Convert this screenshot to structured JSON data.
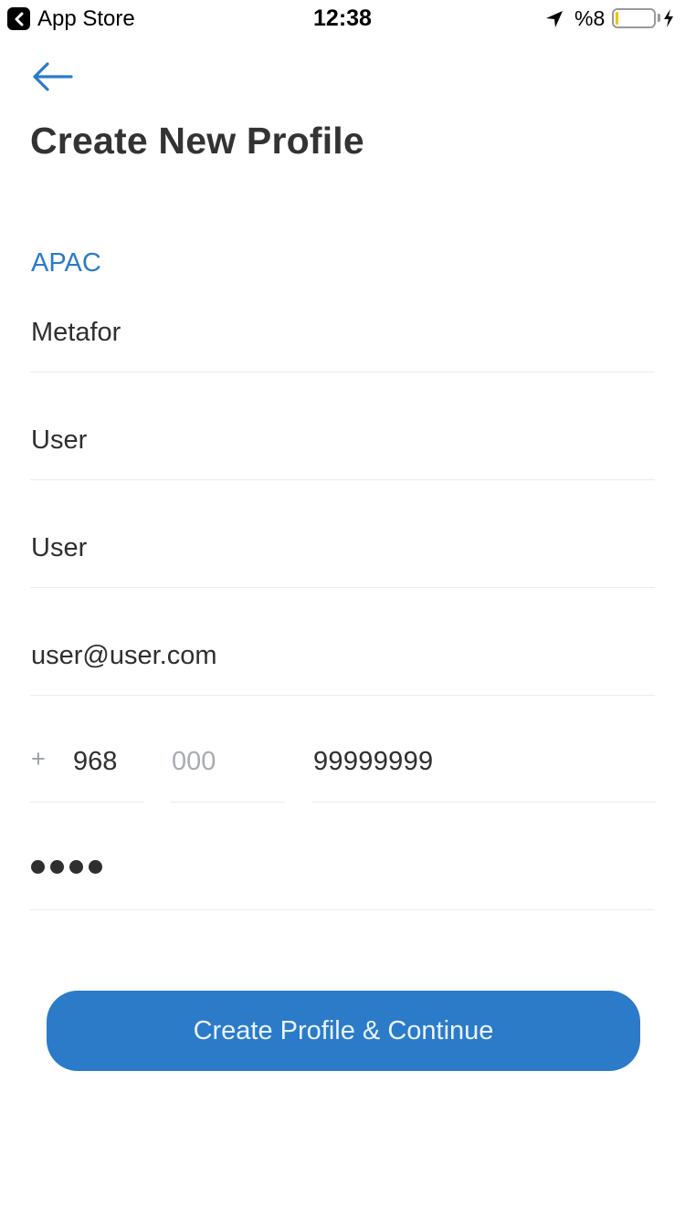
{
  "status_bar": {
    "back_app": "App Store",
    "time": "12:38",
    "battery_text": "%8",
    "battery_level": 0.08,
    "battery_color": "#f2c200"
  },
  "nav": {
    "back_icon": "arrow-left-icon",
    "title": "Create New Profile"
  },
  "form": {
    "region": "APAC",
    "company": "Metafor",
    "first_name": "User",
    "last_name": "User",
    "email": "user@user.com",
    "phone": {
      "plus": "+",
      "country_code": "968",
      "area_placeholder": "000",
      "number": "99999999"
    },
    "password_dot_count": 4
  },
  "actions": {
    "submit_label": "Create Profile & Continue"
  },
  "colors": {
    "accent": "#2b7bc9",
    "text": "#2f2f2f",
    "divider": "#ebebeb",
    "placeholder": "#a8adb3"
  }
}
